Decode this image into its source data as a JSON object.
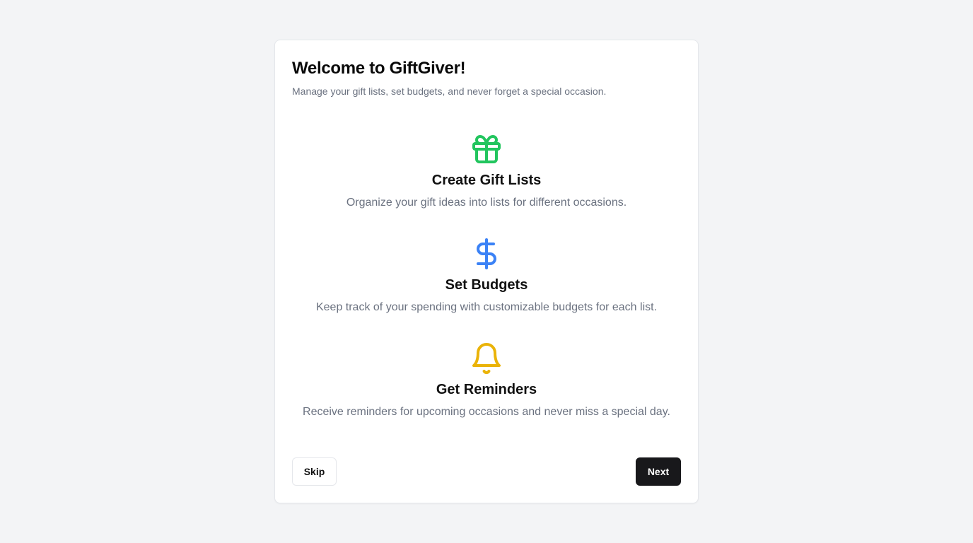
{
  "onboarding": {
    "title": "Welcome to GiftGiver!",
    "subtitle": "Manage your gift lists, set budgets, and never forget a special occasion.",
    "features": [
      {
        "icon": "gift-icon",
        "icon_color": "#22c55e",
        "title": "Create Gift Lists",
        "description": "Organize your gift ideas into lists for different occasions."
      },
      {
        "icon": "dollar-sign-icon",
        "icon_color": "#3b82f6",
        "title": "Set Budgets",
        "description": "Keep track of your spending with customizable budgets for each list."
      },
      {
        "icon": "bell-icon",
        "icon_color": "#eab308",
        "title": "Get Reminders",
        "description": "Receive reminders for upcoming occasions and never miss a special day."
      }
    ],
    "skip_label": "Skip",
    "next_label": "Next"
  },
  "colors": {
    "background": "#f3f4f6",
    "card": "#ffffff",
    "primary_button": "#18181b",
    "muted_text": "#6b7280"
  }
}
